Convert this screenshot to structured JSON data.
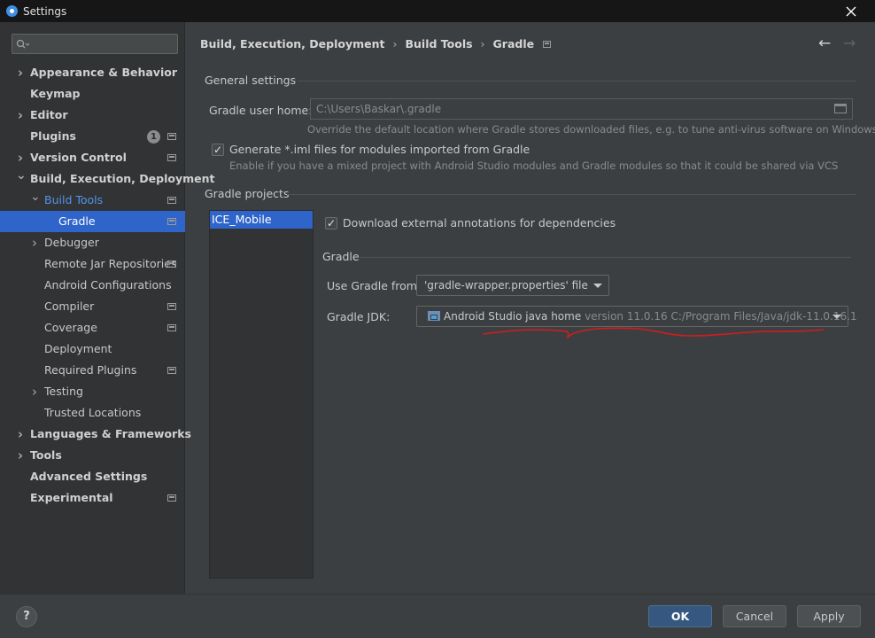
{
  "window": {
    "title": "Settings"
  },
  "search": {
    "placeholder": ""
  },
  "sidebar": {
    "items": [
      {
        "label": "Appearance & Behavior",
        "bold": true,
        "arrow": "right",
        "level": 0
      },
      {
        "label": "Keymap",
        "bold": true,
        "level": 0
      },
      {
        "label": "Editor",
        "bold": true,
        "arrow": "right",
        "level": 0
      },
      {
        "label": "Plugins",
        "bold": true,
        "level": 0,
        "badge": "1",
        "project": true
      },
      {
        "label": "Version Control",
        "bold": true,
        "arrow": "right",
        "level": 0,
        "project": true
      },
      {
        "label": "Build, Execution, Deployment",
        "bold": true,
        "arrow": "down",
        "level": 0
      },
      {
        "label": "Build Tools",
        "arrow": "down",
        "level": 1,
        "project": true,
        "accent": true
      },
      {
        "label": "Gradle",
        "level": 2,
        "project": true,
        "selected": true
      },
      {
        "label": "Debugger",
        "arrow": "right",
        "level": 1
      },
      {
        "label": "Remote Jar Repositories",
        "level": 1,
        "project": true
      },
      {
        "label": "Android Configurations",
        "level": 1
      },
      {
        "label": "Compiler",
        "level": 1,
        "project": true
      },
      {
        "label": "Coverage",
        "level": 1,
        "project": true
      },
      {
        "label": "Deployment",
        "level": 1
      },
      {
        "label": "Required Plugins",
        "level": 1,
        "project": true
      },
      {
        "label": "Testing",
        "arrow": "right",
        "level": 1
      },
      {
        "label": "Trusted Locations",
        "level": 1
      },
      {
        "label": "Languages & Frameworks",
        "bold": true,
        "arrow": "right",
        "level": 0
      },
      {
        "label": "Tools",
        "bold": true,
        "arrow": "right",
        "level": 0
      },
      {
        "label": "Advanced Settings",
        "bold": true,
        "level": 0
      },
      {
        "label": "Experimental",
        "bold": true,
        "level": 0,
        "project": true
      }
    ]
  },
  "breadcrumb": {
    "part1": "Build, Execution, Deployment",
    "part2": "Build Tools",
    "part3": "Gradle",
    "separator": "›"
  },
  "nav": {
    "back": "←",
    "forward": "→"
  },
  "general": {
    "title": "General settings",
    "user_home_label": "Gradle user home:",
    "user_home_value": "C:\\Users\\Baskar\\.gradle",
    "user_home_hint": "Override the default location where Gradle stores downloaded files, e.g. to tune anti-virus software on Windows",
    "generate_iml_label": "Generate *.iml files for modules imported from Gradle",
    "generate_iml_hint": "Enable if you have a mixed project with Android Studio modules and Gradle modules so that it could be shared via VCS",
    "generate_iml_checked": true
  },
  "projects": {
    "title": "Gradle projects",
    "items": [
      "ICE_Mobile"
    ],
    "download_annotations_label": "Download external annotations for dependencies",
    "download_annotations_checked": true,
    "gradle_section_title": "Gradle",
    "use_gradle_from_label": "Use Gradle from:",
    "use_gradle_from_value": "'gradle-wrapper.properties' file",
    "gradle_jdk_label": "Gradle JDK:",
    "gradle_jdk_name": "Android Studio java home",
    "gradle_jdk_detail": "version 11.0.16 C:/Program Files/Java/jdk-11.0.16.1"
  },
  "footer": {
    "help": "?",
    "ok": "OK",
    "cancel": "Cancel",
    "apply": "Apply"
  },
  "colors": {
    "selection": "#2f65ca",
    "accent_text": "#5394ec",
    "annotation": "#d11d1d",
    "primary_button": "#365880"
  }
}
